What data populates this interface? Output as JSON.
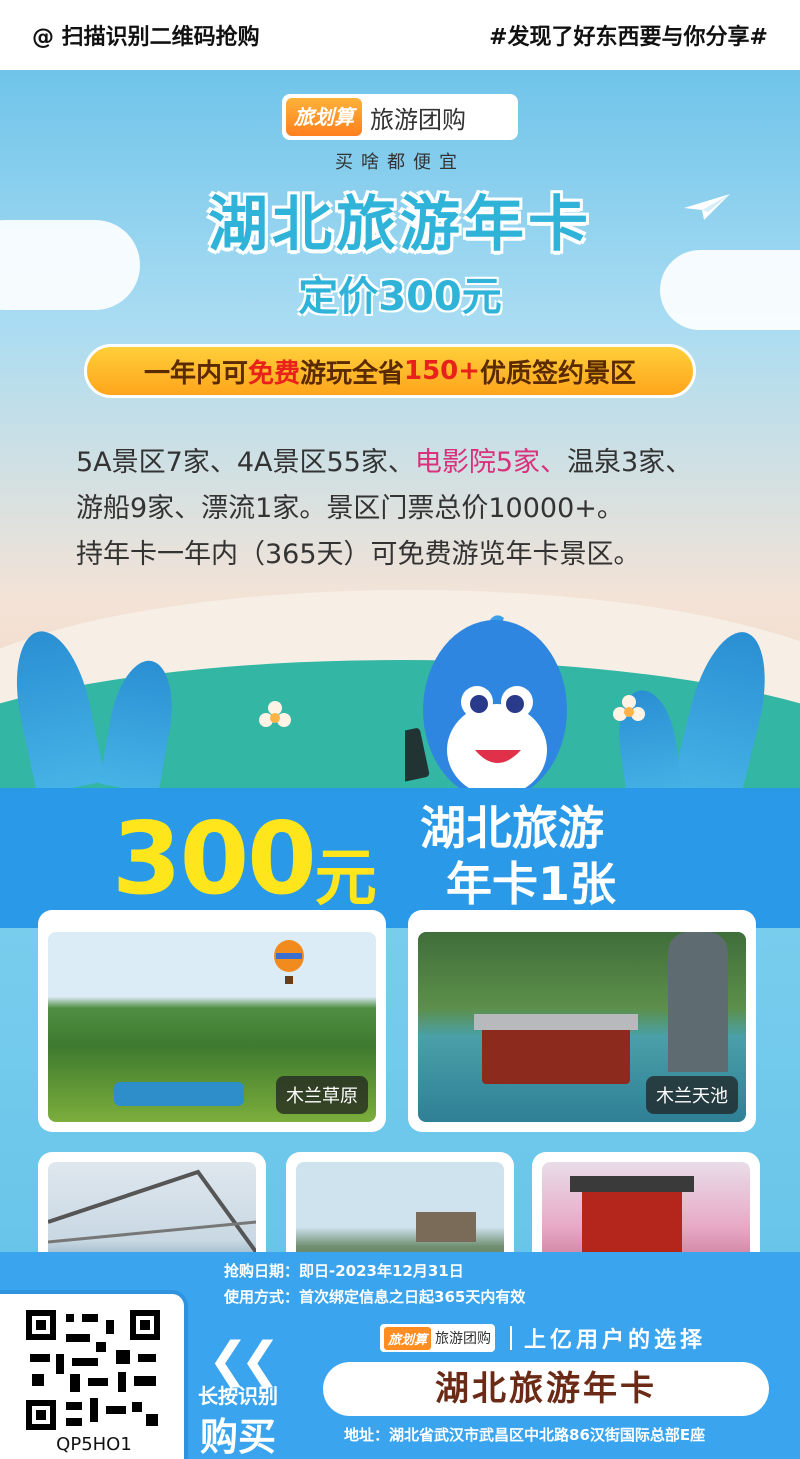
{
  "header": {
    "scan_text": "@ 扫描识别二维码抢购",
    "share_text": "#发现了好东西要与你分享#"
  },
  "poster": {
    "brand_badge": "旅划算",
    "brand_name": "旅游团购",
    "slogan": "买啥都便宜",
    "title": "湖北旅游年卡",
    "price_line": "定价300元",
    "banner": {
      "part1": "一年内可",
      "highlight1": "免费",
      "part2": "游玩全省",
      "highlight2": "150+",
      "part3": "优质签约景区"
    },
    "description": {
      "line1_a": "5A景区7家、4A景区55家、",
      "line1_highlight": "电影院5家、",
      "line1_b": "温泉3家、",
      "line2": "游船9家、漂流1家。景区门票总价10000+。",
      "line3": "持年卡一年内（365天）可免费游览年卡景区。"
    }
  },
  "price_band": {
    "price": "300",
    "unit": "元",
    "title_line1": "湖北旅游",
    "title_line2": "年卡1张"
  },
  "photos": [
    {
      "label": "木兰草原"
    },
    {
      "label": "木兰天池"
    }
  ],
  "footer": {
    "purchase_date": "抢购日期：即日-2023年12月31日",
    "usage": "使用方式：首次绑定信息之日起365天内有效",
    "qr_code_text": "QP5HO1",
    "press_label": "长按识别",
    "buy_label": "购买",
    "brand_badge": "旅划算",
    "brand_name": "旅游团购",
    "users_text": "上亿用户的选择",
    "card_name": "湖北旅游年卡",
    "address": "地址：湖北省武汉市武昌区中北路86汉街国际总部E座"
  },
  "colors": {
    "title_blue": "#2fb3d8",
    "band_blue": "#2a9ae8",
    "price_yellow": "#ffe51c",
    "banner_orange": "#ffa51c",
    "highlight_red": "#e8211a",
    "highlight_pink": "#d9317c"
  }
}
